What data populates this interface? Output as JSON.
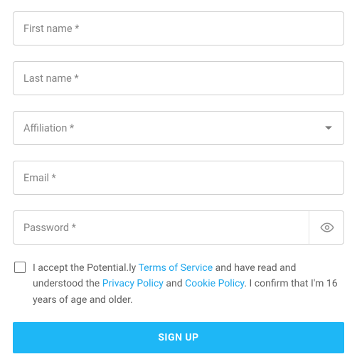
{
  "fields": {
    "first_name": {
      "placeholder": "First name *"
    },
    "last_name": {
      "placeholder": "Last name *"
    },
    "affiliation": {
      "placeholder": "Affiliation *"
    },
    "email": {
      "placeholder": "Email *"
    },
    "password": {
      "placeholder": "Password *"
    }
  },
  "terms": {
    "prefix": "I accept the Potential.ly ",
    "tos": "Terms of Service",
    "mid1": " and have read and understood the ",
    "privacy": "Privacy Policy",
    "mid2": " and ",
    "cookie": "Cookie Policy",
    "suffix": ". I confirm that I'm 16 years of age and older."
  },
  "signup_label": "SIGN UP"
}
